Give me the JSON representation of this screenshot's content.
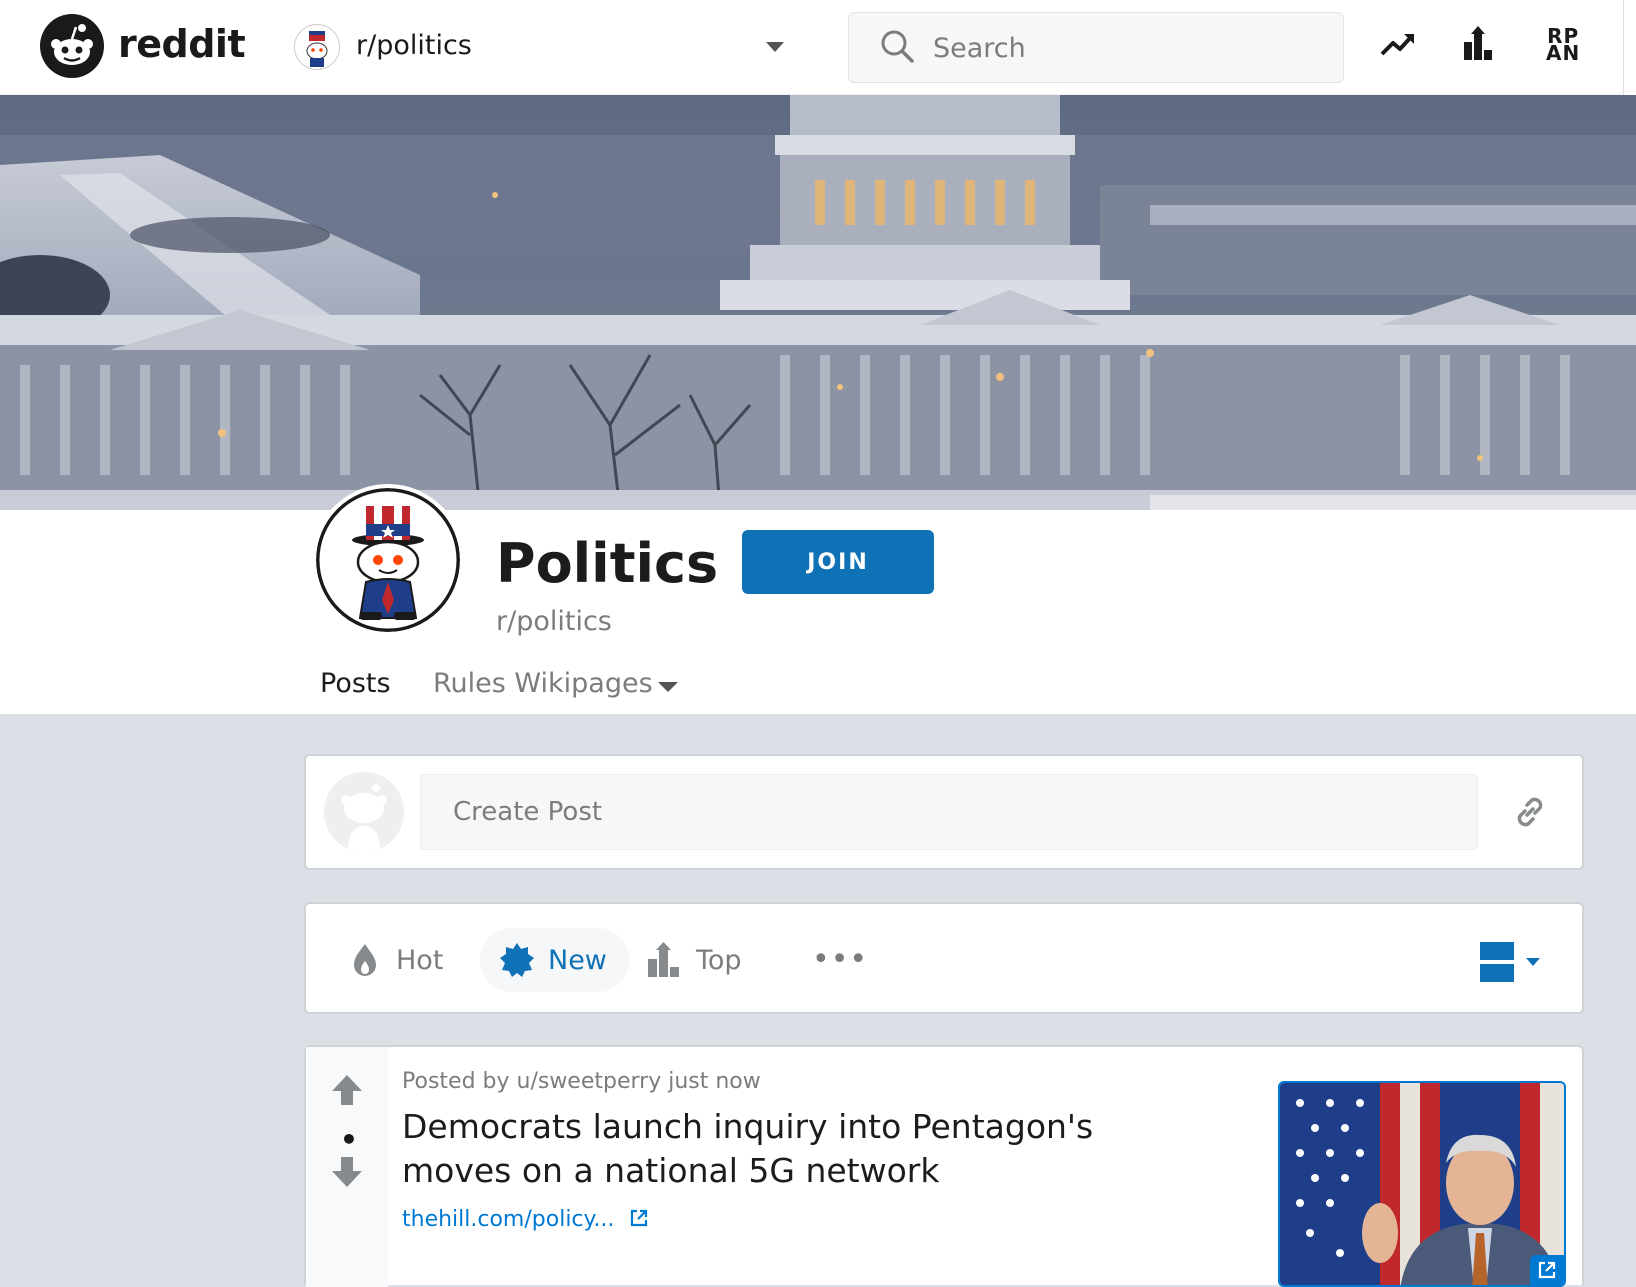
{
  "header": {
    "brand": "reddit",
    "subreddit_switcher": "r/politics",
    "search_placeholder": "Search",
    "rpan_label": "RP\nAN"
  },
  "subreddit": {
    "title": "Politics",
    "name": "r/politics",
    "join_label": "JOIN",
    "tabs": [
      {
        "label": "Posts",
        "active": true
      },
      {
        "label": "Rules Wikipages",
        "active": false
      }
    ]
  },
  "create_post": {
    "placeholder": "Create Post"
  },
  "sort": {
    "options": [
      {
        "label": "Hot",
        "icon": "flame-icon",
        "active": false
      },
      {
        "label": "New",
        "icon": "new-badge-icon",
        "active": true
      },
      {
        "label": "Top",
        "icon": "top-bars-icon",
        "active": false
      }
    ],
    "more_label": "•••"
  },
  "post": {
    "meta": "Posted by u/sweetperry just now",
    "title": "Democrats launch inquiry into Pentagon's moves on a national 5G network",
    "link_text": "thehill.com/policy...",
    "vote_score": "•"
  },
  "colors": {
    "accent": "#0f72b7",
    "link": "#0079d3",
    "page_bg": "#dae0e6"
  }
}
